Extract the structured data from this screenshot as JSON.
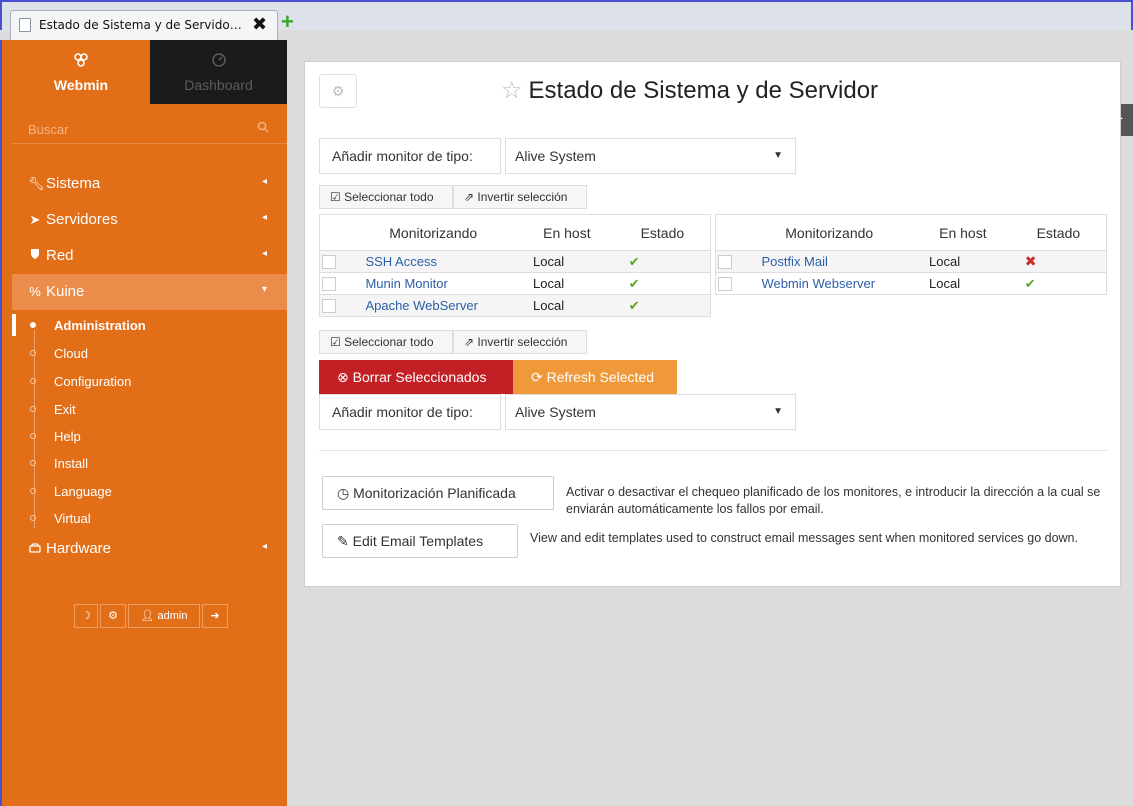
{
  "browser": {
    "tab_title": "Estado de Sistema y de Servido…",
    "close_glyph": "✖",
    "new_tab_glyph": "+"
  },
  "sidebar": {
    "switch": {
      "webmin_label": "Webmin",
      "webmin_icon": "webmin-logo-icon",
      "dashboard_label": "Dashboard",
      "dashboard_icon": "dashboard-gauge-icon"
    },
    "search_placeholder": "Buscar",
    "nav": [
      {
        "label": "Sistema",
        "icon": "wrench-icon"
      },
      {
        "label": "Servidores",
        "icon": "rocket-icon"
      },
      {
        "label": "Red",
        "icon": "shield-icon"
      },
      {
        "label": "Kuine",
        "icon": "link-icon"
      },
      {
        "label": "Hardware",
        "icon": "hdd-icon"
      }
    ],
    "sub_items": [
      "Administration",
      "Cloud",
      "Configuration",
      "Exit",
      "Help",
      "Install",
      "Language",
      "Virtual"
    ],
    "bottom": {
      "user_label": "admin"
    }
  },
  "main": {
    "title": "Estado de Sistema y de Servidor",
    "add_monitor_label": "Añadir monitor de tipo:",
    "add_monitor_value": "Alive System",
    "select_all": "Seleccionar todo",
    "invert_selection": "Invertir selección",
    "columns": [
      "Monitorizando",
      "En host",
      "Estado"
    ],
    "left_table": [
      {
        "name": "SSH Access",
        "host": "Local",
        "status": "up"
      },
      {
        "name": "Munin Monitor",
        "host": "Local",
        "status": "up"
      },
      {
        "name": "Apache WebServer",
        "host": "Local",
        "status": "up"
      }
    ],
    "right_table": [
      {
        "name": "Postfix Mail",
        "host": "Local",
        "status": "down"
      },
      {
        "name": "Webmin Webserver",
        "host": "Local",
        "status": "up"
      }
    ],
    "delete_selected": "Borrar Seleccionados",
    "refresh_selected": "Refresh Selected",
    "scheduled_button": "Monitorización Planificada",
    "scheduled_desc": "Activar o desactivar el chequeo planificado de los monitores, e introducir la dirección a la cual se enviarán automáticamente los fallos por email.",
    "templates_button": "Edit Email Templates",
    "templates_desc": "View and edit templates used to construct email messages sent when monitored services go down.",
    "colors": {
      "sidebar": "#e36e18",
      "delete": "#c32026",
      "refresh": "#f0993b",
      "link": "#2b5fa8",
      "ok": "#5aa521",
      "bad": "#c9302c"
    }
  }
}
